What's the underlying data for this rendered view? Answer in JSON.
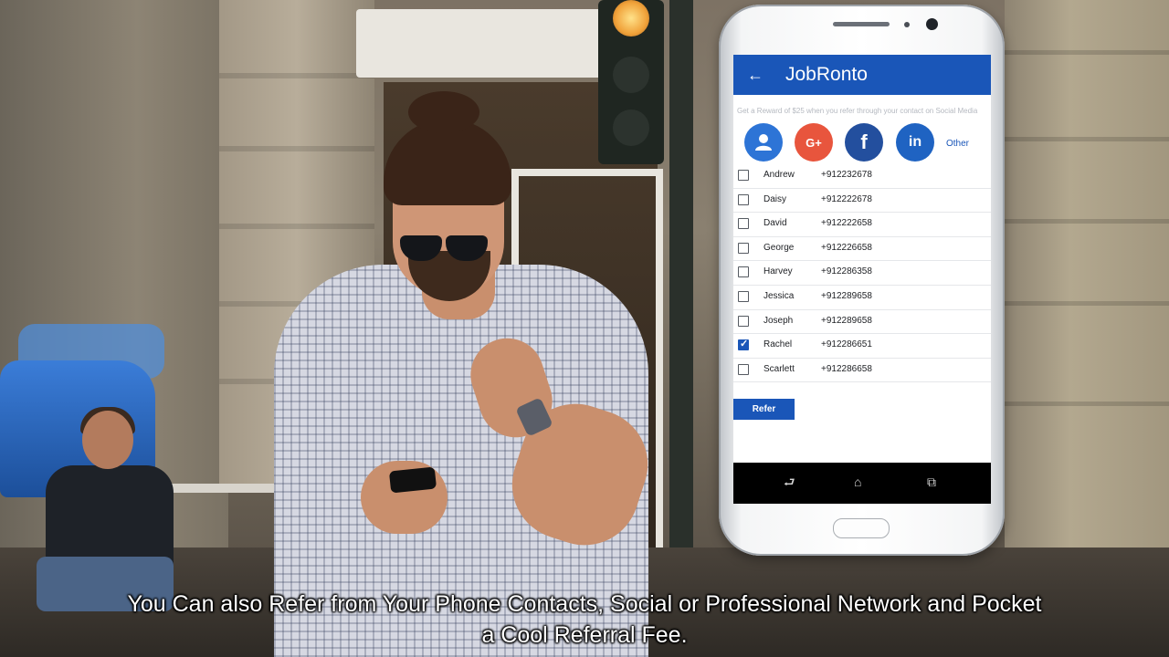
{
  "app": {
    "title": "JobRonto",
    "back_icon": "arrow-left-icon"
  },
  "promo_text": "Get a Reward of $25 when you refer through your contact on Social Media",
  "share_options": [
    {
      "icon": "contacts-icon",
      "color": "#2d74d6"
    },
    {
      "icon": "google-plus-icon",
      "label": "G+",
      "color": "#e8553d"
    },
    {
      "icon": "facebook-icon",
      "label": "f",
      "color": "#234f9e"
    },
    {
      "icon": "linkedin-icon",
      "label": "in",
      "color": "#1f63c2"
    }
  ],
  "other_label": "Other",
  "contacts": [
    {
      "name": "Andrew",
      "phone": "+912232678",
      "checked": false
    },
    {
      "name": "Daisy",
      "phone": "+912222678",
      "checked": false
    },
    {
      "name": "David",
      "phone": "+912222658",
      "checked": false
    },
    {
      "name": "George",
      "phone": "+912226658",
      "checked": false
    },
    {
      "name": "Harvey",
      "phone": "+912286358",
      "checked": false
    },
    {
      "name": "Jessica",
      "phone": "+912289658",
      "checked": false
    },
    {
      "name": "Joseph",
      "phone": "+912289658",
      "checked": false
    },
    {
      "name": "Rachel",
      "phone": "+912286651",
      "checked": true
    },
    {
      "name": "Scarlett",
      "phone": "+912286658",
      "checked": false
    }
  ],
  "refer_label": "Refer",
  "navbar_icons": [
    "back-nav-icon",
    "home-nav-icon",
    "recents-nav-icon"
  ],
  "subtitle": {
    "line1": "You Can also Refer from Your Phone Contacts, Social or Professional Network and Pocket",
    "line2": "a Cool Referral Fee."
  },
  "colors": {
    "accent": "#1a56b8",
    "navbar": "#000000"
  }
}
